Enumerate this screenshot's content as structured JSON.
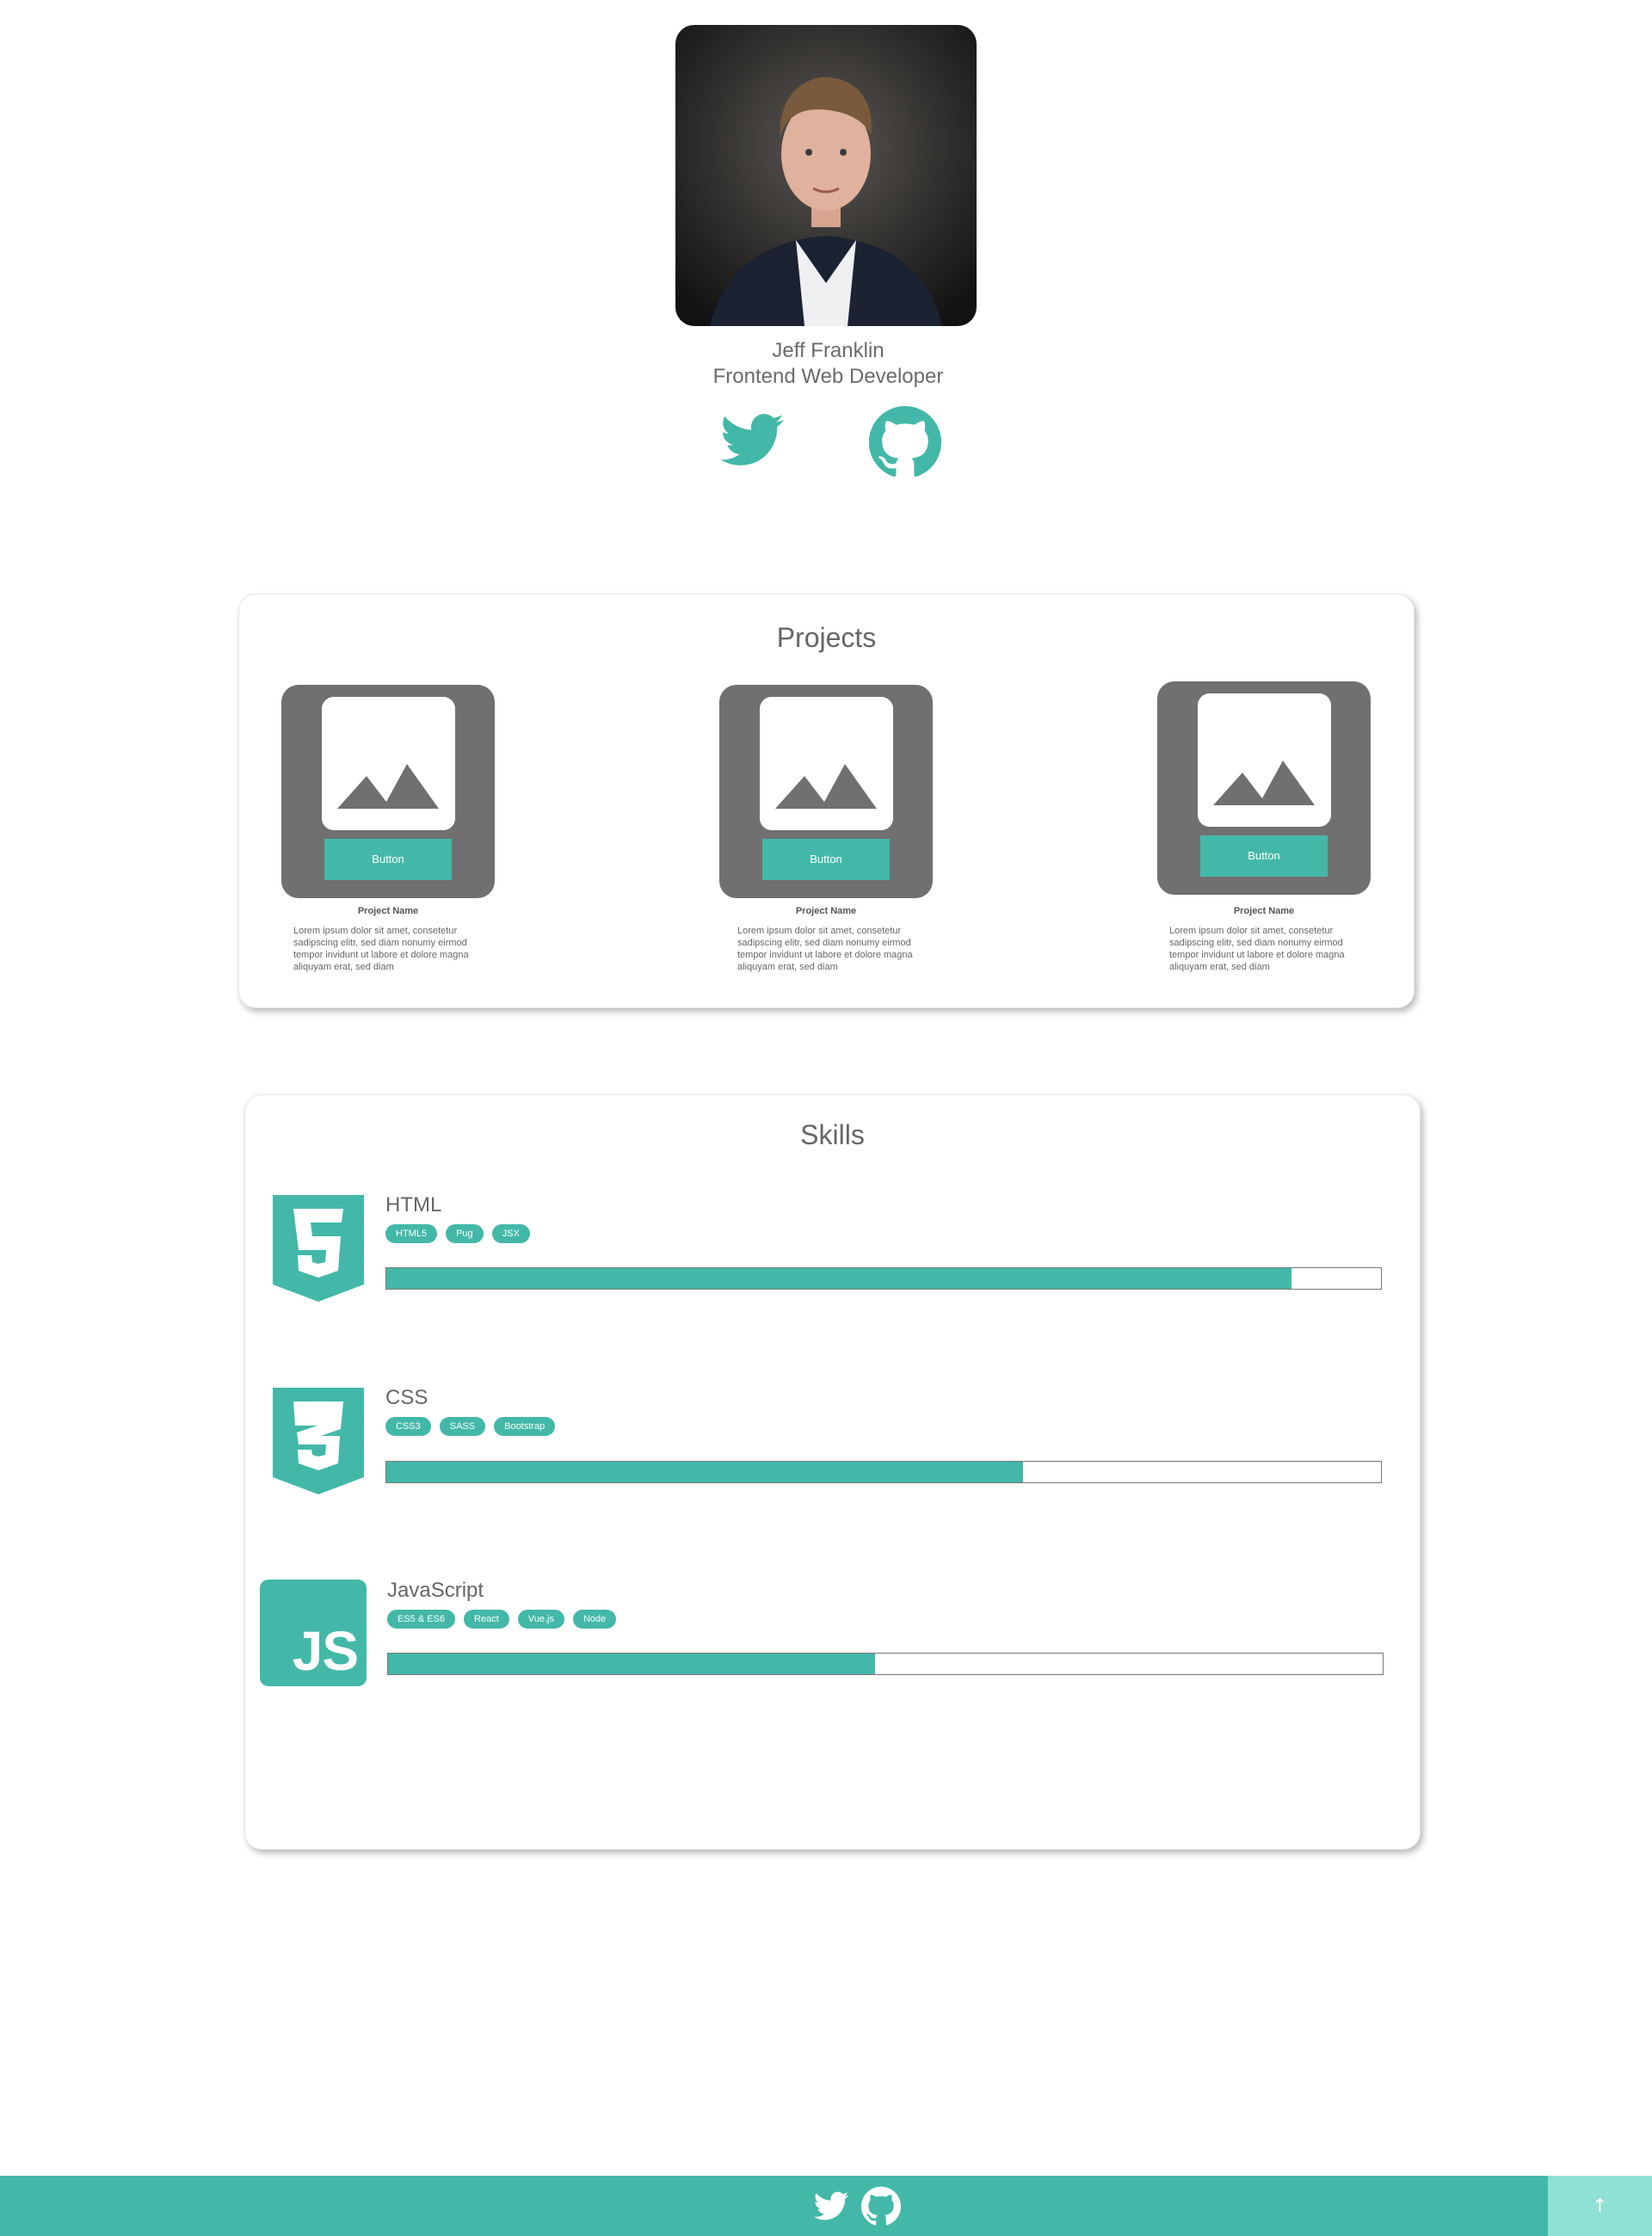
{
  "profile": {
    "name": "Jeff Franklin",
    "title": "Frontend Web Developer",
    "social": [
      "twitter-icon",
      "github-icon"
    ]
  },
  "projects": {
    "heading": "Projects",
    "items": [
      {
        "button_label": "Button",
        "name": "Project Name",
        "description": "Lorem ipsum dolor sit amet, consetetur sadipscing elitr, sed diam nonumy eirmod tempor invidunt ut labore et dolore magna aliquyam erat, sed diam"
      },
      {
        "button_label": "Button",
        "name": "Project Name",
        "description": "Lorem ipsum dolor sit amet, consetetur sadipscing elitr, sed diam nonumy eirmod tempor invidunt ut labore et dolore magna aliquyam erat, sed diam"
      },
      {
        "button_label": "Button",
        "name": "Project Name",
        "description": "Lorem ipsum dolor sit amet, consetetur sadipscing elitr, sed diam nonumy eirmod tempor invidunt ut labore et dolore magna aliquyam erat, sed diam"
      }
    ]
  },
  "skills": {
    "heading": "Skills",
    "items": [
      {
        "name": "HTML",
        "icon": "html5-icon",
        "tags": [
          "HTML5",
          "Pug",
          "JSX"
        ],
        "level": 0.91
      },
      {
        "name": "CSS",
        "icon": "css3-icon",
        "tags": [
          "CSS3",
          "SASS",
          "Bootstrap"
        ],
        "level": 0.64
      },
      {
        "name": "JavaScript",
        "icon": "js-icon",
        "js_logo_text": "JS",
        "tags": [
          "ES5 & ES6",
          "React",
          "Vue.js",
          "Node"
        ],
        "level": 0.49
      }
    ]
  },
  "footer": {
    "social": [
      "twitter-icon",
      "github-icon"
    ],
    "back_to_top_icon": "arrow-up-icon",
    "back_to_top_glyph": "↑"
  },
  "colors": {
    "accent": "#43b8a8",
    "accent_light": "#8fe0d5",
    "tile_gray": "#707070",
    "text": "#666666"
  }
}
